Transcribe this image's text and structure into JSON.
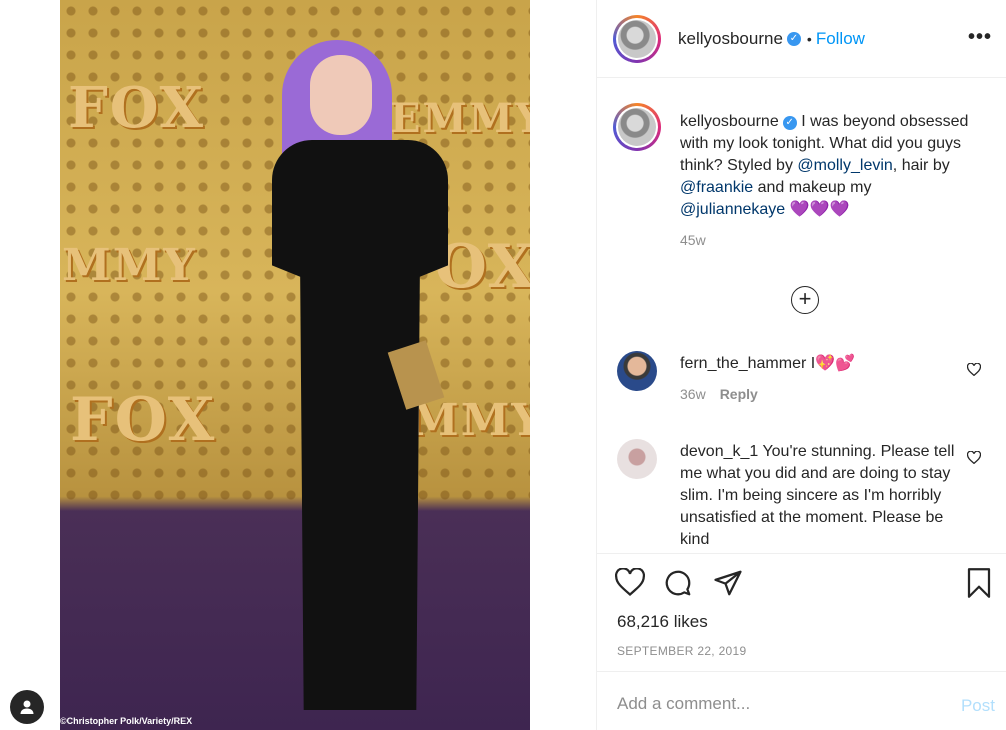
{
  "photo": {
    "credit": "©Christopher Polk/Variety/REX",
    "wall_texts": [
      "FOX",
      "EMMYS",
      "MMY",
      "FOX",
      "FOX",
      "MMY"
    ]
  },
  "post": {
    "username": "kellyosbourne",
    "verified": true,
    "follow_label": "Follow",
    "separator": "•",
    "more_icon": "more-options-icon"
  },
  "caption": {
    "username": "kellyosbourne",
    "text_1": "I was beyond obsessed with my look tonight. What did you guys think? Styled by",
    "mention_1": "@molly_levin",
    "text_2": ", hair by",
    "mention_2": "@fraankie",
    "text_3": "and makeup my",
    "mention_3": "@juliannekaye",
    "emojis": "💜💜💜",
    "time": "45w"
  },
  "comments": [
    {
      "username": "fern_the_hammer",
      "text": "I",
      "emojis": "💖💕",
      "time": "36w",
      "reply_label": "Reply"
    },
    {
      "username": "devon_k_1",
      "text": "You're stunning. Please tell me what you did and are doing to stay slim. I'm being sincere as I'm horribly unsatisfied at the moment. Please be kind"
    }
  ],
  "stats": {
    "likes": "68,216 likes",
    "date": "SEPTEMBER 22, 2019"
  },
  "add_comment": {
    "placeholder": "Add a comment...",
    "post_label": "Post"
  },
  "colors": {
    "accent": "#0095f6",
    "verified": "#3897f0",
    "post_disabled": "#b2dffc",
    "muted": "#8e8e8e"
  }
}
